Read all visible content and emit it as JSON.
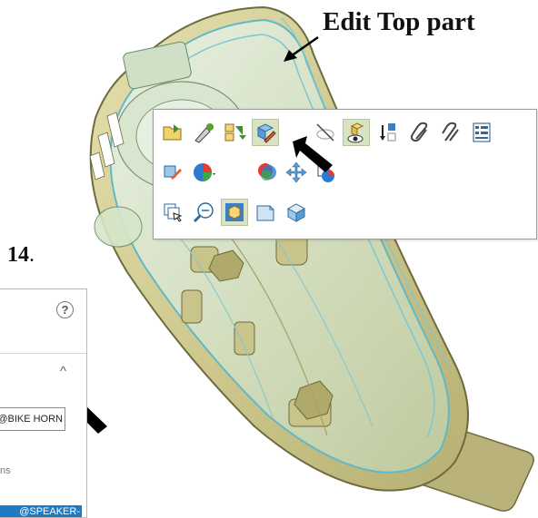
{
  "callout": {
    "text": "Edit Top part"
  },
  "step": {
    "number": "14",
    "period": "."
  },
  "property_panel": {
    "help_glyph": "?",
    "collapse_glyph": "^",
    "reference_field": {
      "value": "@BIKE HORN"
    },
    "options_label": "ns",
    "selected_item": "@SPEAKER-"
  },
  "context_toolbar": {
    "rows": [
      [
        "open-part-icon",
        "edit-sketch-icon",
        "hide-show-bodies-icon",
        "edit-part-icon",
        "hide-icon",
        "isolate-icon",
        "rollback-icon",
        "attach-icon",
        "mate-icon",
        "properties-icon"
      ],
      [
        "component-appearance-icon",
        "appearances-icon",
        "change-transparency-icon",
        "move-component-icon",
        "component-color-icon"
      ],
      [
        "select-other-icon",
        "zoom-to-selection-icon",
        "view-normal-icon",
        "view-shaded-icon",
        "view-isometric-icon"
      ]
    ]
  },
  "colors": {
    "part_body": "#c9c48a",
    "part_edge": "#5fb8c8",
    "accent_selection": "#1f7ac4",
    "tool_active_bg": "#d7e3c3"
  }
}
